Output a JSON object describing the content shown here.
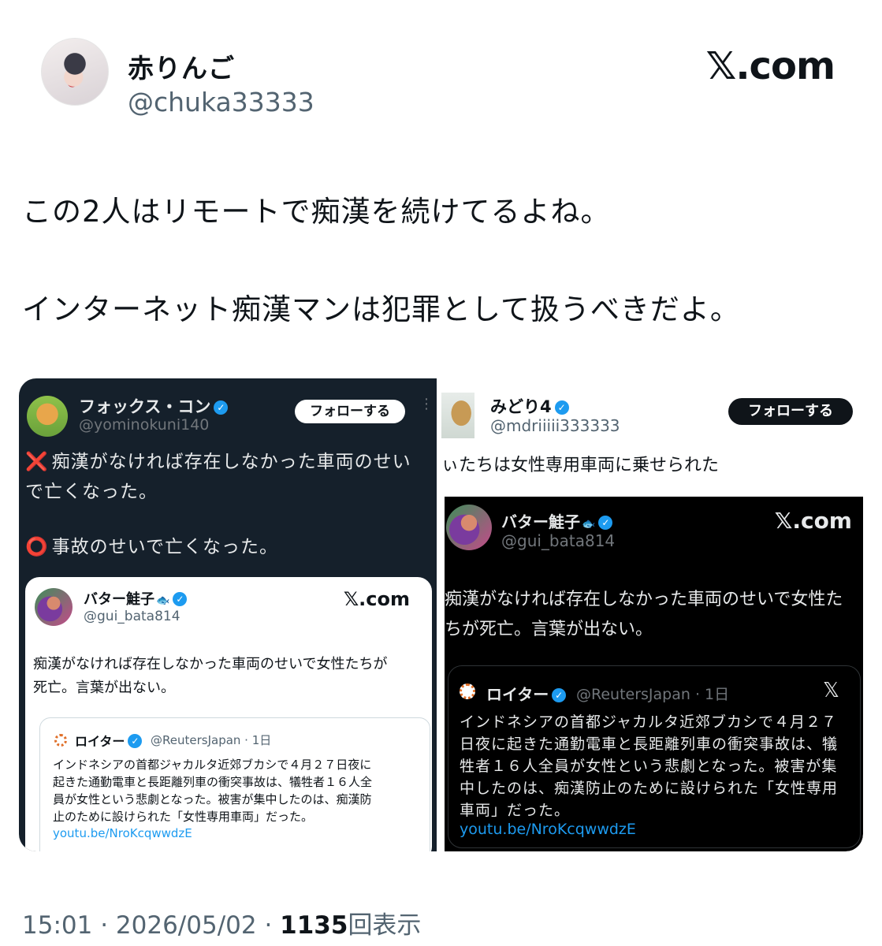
{
  "author": {
    "name": "赤りんご",
    "handle": "@chuka33333"
  },
  "brand": "𝕏.com",
  "tweet": {
    "line1": "この2人はリモートで痴漢を続けてるよね。",
    "line2": "インターネット痴漢マンは犯罪として扱うべきだよ。"
  },
  "left_shot": {
    "name": "フォックス・コン",
    "handle": "@yominokuni140",
    "follow_label": "フォローする",
    "more": "⋮",
    "line1_mark": "❌",
    "line1": "痴漢がなければ存在しなかった車両のせい",
    "line2": "で亡くなった。",
    "line3_mark": "⭕",
    "line3": "事故のせいで亡くなった。",
    "card": {
      "name": "バター鮭子",
      "fish": "🐟",
      "handle": "@gui_bata814",
      "brand": "𝕏.com",
      "text1": "痴漢がなければ存在しなかった車両のせいで女性たちが",
      "text2": "死亡。言葉が出ない。",
      "quote": {
        "name": "ロイター",
        "handle": "@ReutersJapan · 1日",
        "l1": "インドネシアの首都ジャカルタ近郊ブカシで４月２７日夜に",
        "l2": "起きた通勤電車と長距離列車の衝突事故は、犠牲者１６人全",
        "l3": "員が女性という悲劇となった。被害が集中したのは、痴漢防",
        "l4": "止のために設けられた「女性専用車両」だった。",
        "link": "youtu.be/NroKcqwwdzE"
      }
    }
  },
  "right_shot": {
    "name": "みどり4",
    "handle": "@mdriiiii333333",
    "follow_label": "フォローする",
    "text": "ぃたちは女性専用車両に乗せられた",
    "card": {
      "name": "バター鮭子",
      "fish": "🐟",
      "handle": "@gui_bata814",
      "brand": "𝕏.com",
      "text1": "痴漢がなければ存在しなかった車両のせいで女性た",
      "text2": "ちが死亡。言葉が出ない。",
      "quote": {
        "name": "ロイター",
        "handle": "@ReutersJapan · 1日",
        "x": "𝕏",
        "l1": "インドネシアの首都ジャカルタ近郊ブカシで４月２７",
        "l2": "日夜に起きた通勤電車と長距離列車の衝突事故は、犠",
        "l3": "牲者１６人全員が女性という悲劇となった。被害が集",
        "l4": "中したのは、痴漢防止のために設けられた「女性専用",
        "l5": "車両」だった。",
        "link": "youtu.be/NroKcqwwdzE"
      }
    }
  },
  "meta": {
    "time": "15:01",
    "date": "2026/05/02",
    "views": "1135",
    "views_label": "回表示",
    "sep": " · "
  }
}
